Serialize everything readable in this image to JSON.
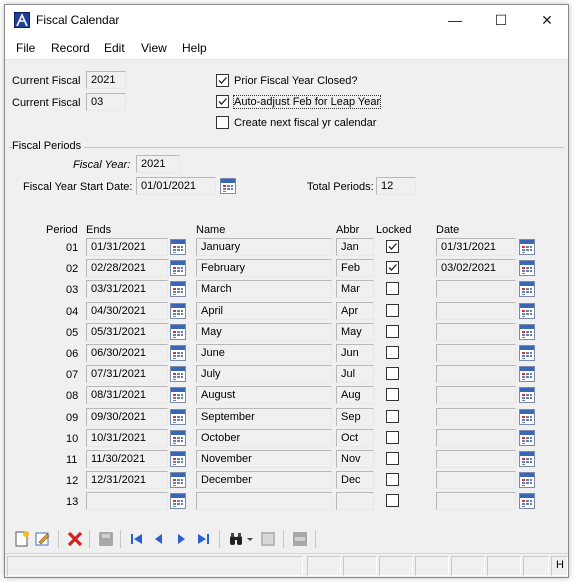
{
  "window": {
    "title": "Fiscal Calendar",
    "controls": {
      "minimize": "—",
      "maximize": "☐",
      "close": "✕"
    }
  },
  "menu": [
    "File",
    "Record",
    "Edit",
    "View",
    "Help"
  ],
  "header": {
    "current_fiscal_label": "Current Fiscal",
    "current_fiscal_year": "2021",
    "current_fiscal_period": "03",
    "options": [
      {
        "label": "Prior Fiscal Year Closed?",
        "checked": true
      },
      {
        "label": "Auto-adjust Feb for Leap Year",
        "checked": true
      },
      {
        "label": "Create next fiscal yr calendar",
        "checked": false
      }
    ]
  },
  "fiscal_periods": {
    "group_label": "Fiscal Periods",
    "fiscal_year_label": "Fiscal Year:",
    "fiscal_year": "2021",
    "start_date_label": "Fiscal Year Start Date:",
    "start_date": "01/01/2021",
    "total_periods_label": "Total Periods:",
    "total_periods": "12",
    "columns": {
      "period": "Period",
      "ends": "Ends",
      "name": "Name",
      "abbr": "Abbr",
      "locked": "Locked",
      "date": "Date"
    },
    "rows": [
      {
        "period": "01",
        "ends": "01/31/2021",
        "name": "January",
        "abbr": "Jan",
        "locked": true,
        "date": "01/31/2021"
      },
      {
        "period": "02",
        "ends": "02/28/2021",
        "name": "February",
        "abbr": "Feb",
        "locked": true,
        "date": "03/02/2021"
      },
      {
        "period": "03",
        "ends": "03/31/2021",
        "name": "March",
        "abbr": "Mar",
        "locked": false,
        "date": ""
      },
      {
        "period": "04",
        "ends": "04/30/2021",
        "name": "April",
        "abbr": "Apr",
        "locked": false,
        "date": ""
      },
      {
        "period": "05",
        "ends": "05/31/2021",
        "name": "May",
        "abbr": "May",
        "locked": false,
        "date": ""
      },
      {
        "period": "06",
        "ends": "06/30/2021",
        "name": "June",
        "abbr": "Jun",
        "locked": false,
        "date": ""
      },
      {
        "period": "07",
        "ends": "07/31/2021",
        "name": "July",
        "abbr": "Jul",
        "locked": false,
        "date": ""
      },
      {
        "period": "08",
        "ends": "08/31/2021",
        "name": "August",
        "abbr": "Aug",
        "locked": false,
        "date": ""
      },
      {
        "period": "09",
        "ends": "09/30/2021",
        "name": "September",
        "abbr": "Sep",
        "locked": false,
        "date": ""
      },
      {
        "period": "10",
        "ends": "10/31/2021",
        "name": "October",
        "abbr": "Oct",
        "locked": false,
        "date": ""
      },
      {
        "period": "11",
        "ends": "11/30/2021",
        "name": "November",
        "abbr": "Nov",
        "locked": false,
        "date": ""
      },
      {
        "period": "12",
        "ends": "12/31/2021",
        "name": "December",
        "abbr": "Dec",
        "locked": false,
        "date": ""
      },
      {
        "period": "13",
        "ends": "",
        "name": "",
        "abbr": "",
        "locked": false,
        "date": ""
      }
    ]
  },
  "toolbar": {
    "buttons": [
      "new-record-icon",
      "edit-record-icon",
      "delete-icon",
      "save-icon",
      "first-record-icon",
      "previous-record-icon",
      "next-record-icon",
      "last-record-icon",
      "find-icon",
      "dropdown-arrow-icon",
      "lookup-icon",
      "options-icon"
    ]
  },
  "statusbar": {
    "right_text": "H"
  },
  "colors": {
    "accent": "#1f3f96",
    "delete": "#d02020",
    "nav": "#2a5fd0"
  }
}
